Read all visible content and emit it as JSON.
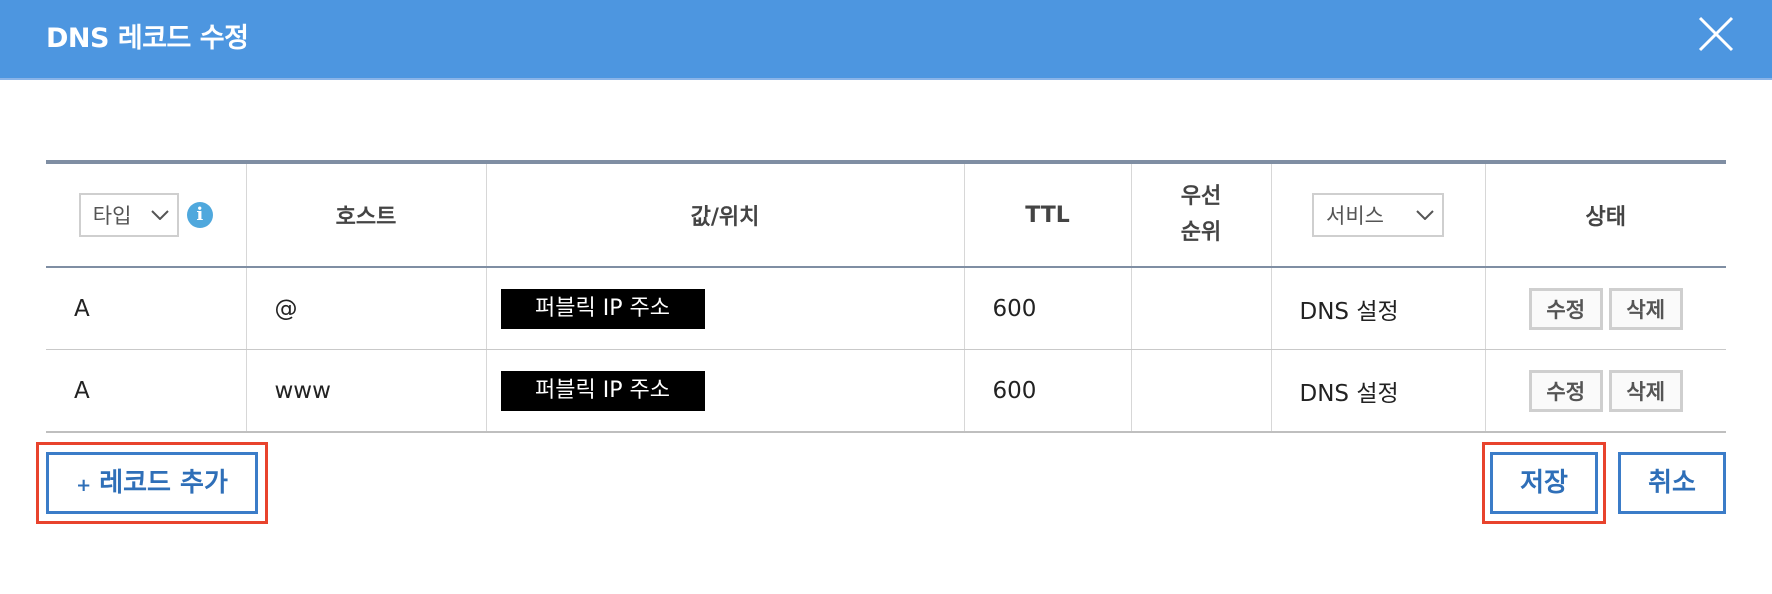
{
  "dialog": {
    "title": "DNS 레코드 수정"
  },
  "table": {
    "headers": {
      "type_select": "타입",
      "info_icon": "i",
      "host": "호스트",
      "value": "값/위치",
      "ttl": "TTL",
      "priority_line1": "우선",
      "priority_line2": "순위",
      "service_select": "서비스",
      "status": "상태"
    },
    "rows": [
      {
        "type": "A",
        "host": "@",
        "value": "퍼블릭 IP 주소",
        "ttl": "600",
        "priority": "",
        "service": "DNS 설정",
        "edit": "수정",
        "delete": "삭제"
      },
      {
        "type": "A",
        "host": "www",
        "value": "퍼블릭 IP 주소",
        "ttl": "600",
        "priority": "",
        "service": "DNS 설정",
        "edit": "수정",
        "delete": "삭제"
      }
    ]
  },
  "footer": {
    "add_icon": "+",
    "add_record": "레코드 추가",
    "save": "저장",
    "cancel": "취소"
  },
  "colors": {
    "header_bg": "#4d96e0",
    "highlight": "#e8432d",
    "button_border": "#3b7cc8"
  }
}
